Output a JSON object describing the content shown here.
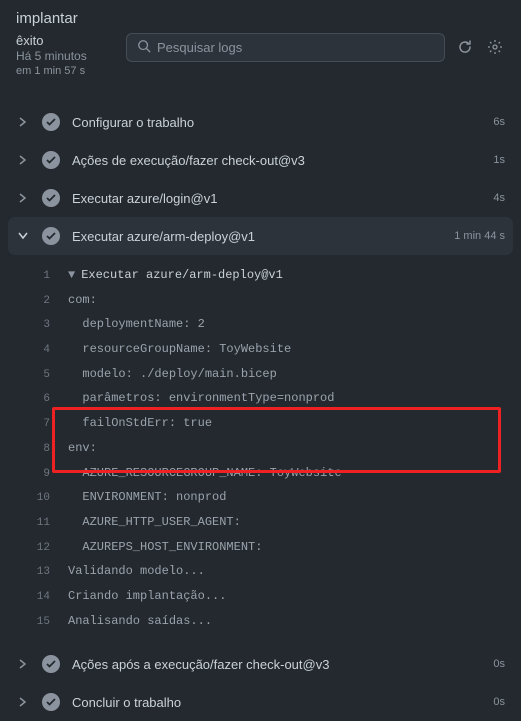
{
  "title": "implantar",
  "status": {
    "label": "êxito",
    "ago": "Há 5 minutos",
    "duration": "em 1 min 57 s"
  },
  "search": {
    "placeholder": "Pesquisar logs"
  },
  "steps": [
    {
      "label": "Configurar o trabalho",
      "dur": "6s"
    },
    {
      "label": "Ações de execução/fazer check-out@v3",
      "dur": "1s"
    },
    {
      "label": "Executar azure/login@v1",
      "dur": "4s"
    },
    {
      "label": "Executar azure/arm-deploy@v1",
      "dur": "1 min 44 s"
    },
    {
      "label": "Ações após a execução/fazer check-out@v3",
      "dur": "0s"
    },
    {
      "label": "Concluir o trabalho",
      "dur": "0s"
    }
  ],
  "log": {
    "header": "Executar azure/arm-deploy@v1",
    "lines": [
      {
        "n": 2,
        "t": "com:"
      },
      {
        "n": 3,
        "t": "  deploymentName: 2"
      },
      {
        "n": 4,
        "t": "  resourceGroupName: ToyWebsite"
      },
      {
        "n": 5,
        "t": "  modelo: ./deploy/main.bicep"
      },
      {
        "n": 6,
        "t": "  parâmetros: environmentType=nonprod"
      },
      {
        "n": 7,
        "t": "  failOnStdErr: true"
      },
      {
        "n": 8,
        "t": "env:"
      },
      {
        "n": 9,
        "t": "  AZURE_RESOURCEGROUP_NAME: ToyWebsite"
      },
      {
        "n": 10,
        "t": "  ENVIRONMENT: nonprod"
      },
      {
        "n": 11,
        "t": "  AZURE_HTTP_USER_AGENT:"
      },
      {
        "n": 12,
        "t": "  AZUREPS_HOST_ENVIRONMENT:"
      },
      {
        "n": 13,
        "t": "Validando modelo..."
      },
      {
        "n": 14,
        "t": "Criando implantação..."
      },
      {
        "n": 15,
        "t": "Analisando saídas..."
      }
    ]
  }
}
